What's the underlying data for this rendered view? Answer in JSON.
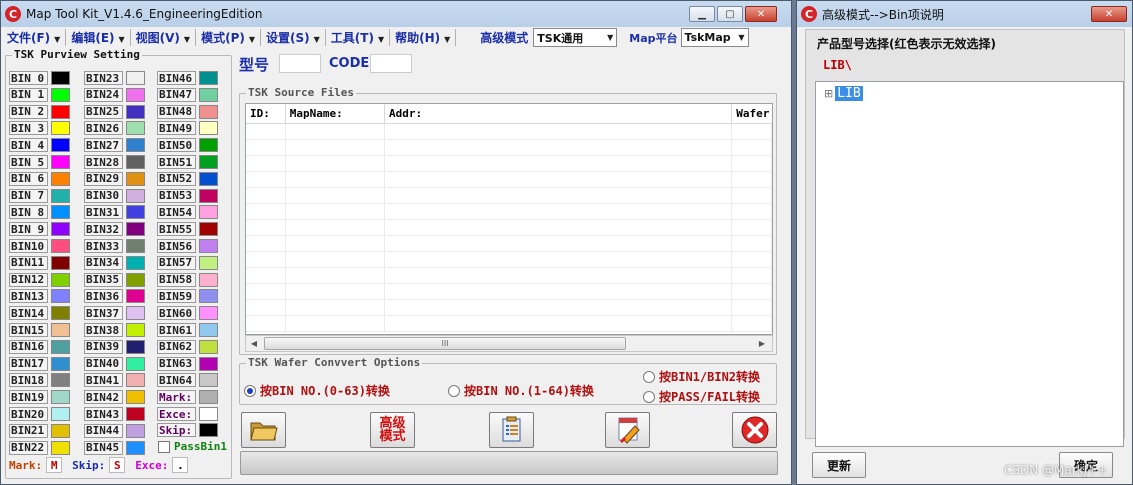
{
  "main": {
    "title": "Map Tool Kit_V1.4.6_EngineeringEdition",
    "menu": [
      {
        "label": "文件(F)"
      },
      {
        "label": "编辑(E)"
      },
      {
        "label": "视图(V)"
      },
      {
        "label": "模式(P)"
      },
      {
        "label": "设置(S)"
      },
      {
        "label": "工具(T)"
      },
      {
        "label": "帮助(H)"
      }
    ],
    "adv_mode_label": "高级模式",
    "adv_mode_value": "TSK通用",
    "platform_label": "Map平台",
    "platform_value": "TskMap",
    "tsk_purview_title": "TSK Purview Setting",
    "bins_col1": [
      {
        "label": "BIN 0",
        "color": "#000000"
      },
      {
        "label": "BIN 1",
        "color": "#00ff00"
      },
      {
        "label": "BIN 2",
        "color": "#ff0000"
      },
      {
        "label": "BIN 3",
        "color": "#ffff00"
      },
      {
        "label": "BIN 4",
        "color": "#0000ff"
      },
      {
        "label": "BIN 5",
        "color": "#ff00ff"
      },
      {
        "label": "BIN 6",
        "color": "#ff8000"
      },
      {
        "label": "BIN 7",
        "color": "#20b2aa"
      },
      {
        "label": "BIN 8",
        "color": "#0090ff"
      },
      {
        "label": "BIN 9",
        "color": "#9000ff"
      },
      {
        "label": "BIN10",
        "color": "#ff4f7f"
      },
      {
        "label": "BIN11",
        "color": "#800000"
      },
      {
        "label": "BIN12",
        "color": "#80d000"
      },
      {
        "label": "BIN13",
        "color": "#8080ff"
      },
      {
        "label": "BIN14",
        "color": "#808000"
      },
      {
        "label": "BIN15",
        "color": "#f0c090"
      },
      {
        "label": "BIN16",
        "color": "#4fa0a0"
      },
      {
        "label": "BIN17",
        "color": "#2f8fd0"
      },
      {
        "label": "BIN18",
        "color": "#808080"
      },
      {
        "label": "BIN19",
        "color": "#a0d8c8"
      },
      {
        "label": "BIN20",
        "color": "#b0f0f0"
      },
      {
        "label": "BIN21",
        "color": "#e0c000"
      },
      {
        "label": "BIN22",
        "color": "#f0e000"
      }
    ],
    "bins_col2": [
      {
        "label": "BIN23",
        "color": "#f0f0f0"
      },
      {
        "label": "BIN24",
        "color": "#f070f0"
      },
      {
        "label": "BIN25",
        "color": "#4030c0"
      },
      {
        "label": "BIN26",
        "color": "#a0e0b0"
      },
      {
        "label": "BIN27",
        "color": "#3080d0"
      },
      {
        "label": "BIN28",
        "color": "#606060"
      },
      {
        "label": "BIN29",
        "color": "#e09010"
      },
      {
        "label": "BIN30",
        "color": "#d0b0e0"
      },
      {
        "label": "BIN31",
        "color": "#4040e0"
      },
      {
        "label": "BIN32",
        "color": "#800080"
      },
      {
        "label": "BIN33",
        "color": "#708070"
      },
      {
        "label": "BIN34",
        "color": "#00b0b0"
      },
      {
        "label": "BIN35",
        "color": "#80a000"
      },
      {
        "label": "BIN36",
        "color": "#e00090"
      },
      {
        "label": "BIN37",
        "color": "#e0c0f0"
      },
      {
        "label": "BIN38",
        "color": "#c0f000"
      },
      {
        "label": "BIN39",
        "color": "#202070"
      },
      {
        "label": "BIN40",
        "color": "#30f0a0"
      },
      {
        "label": "BIN41",
        "color": "#f0b0b0"
      },
      {
        "label": "BIN42",
        "color": "#f0c000"
      },
      {
        "label": "BIN43",
        "color": "#c00020"
      },
      {
        "label": "BIN44",
        "color": "#c0a0e0"
      },
      {
        "label": "BIN45",
        "color": "#1e90ff"
      }
    ],
    "bins_col3": [
      {
        "label": "BIN46",
        "color": "#009090"
      },
      {
        "label": "BIN47",
        "color": "#70d0a0"
      },
      {
        "label": "BIN48",
        "color": "#f09090"
      },
      {
        "label": "BIN49",
        "color": "#ffffc0"
      },
      {
        "label": "BIN50",
        "color": "#00a000"
      },
      {
        "label": "BIN51",
        "color": "#00a020"
      },
      {
        "label": "BIN52",
        "color": "#0050d0"
      },
      {
        "label": "BIN53",
        "color": "#c00060"
      },
      {
        "label": "BIN54",
        "color": "#ffa0e0"
      },
      {
        "label": "BIN55",
        "color": "#a00000"
      },
      {
        "label": "BIN56",
        "color": "#c080f0"
      },
      {
        "label": "BIN57",
        "color": "#c0f080"
      },
      {
        "label": "BIN58",
        "color": "#ffb0d0"
      },
      {
        "label": "BIN59",
        "color": "#9090f0"
      },
      {
        "label": "BIN60",
        "color": "#ff90ff"
      },
      {
        "label": "BIN61",
        "color": "#90c8f0"
      },
      {
        "label": "BIN62",
        "color": "#c0e040"
      },
      {
        "label": "BIN63",
        "color": "#b000b0"
      },
      {
        "label": "BIN64",
        "color": "#c8c8c8"
      }
    ],
    "mark_label": "Mark:",
    "mark_color": "#b0b0b0",
    "exce_label": "Exce:",
    "exce_color": "#ffffff",
    "skip_label": "Skip:",
    "skip_color": "#000000",
    "passbin_label": "PassBin1",
    "bottom_mark_label": "Mark:",
    "bottom_mark_value": "M",
    "bottom_skip_label": "Skip:",
    "bottom_skip_value": "S",
    "bottom_exce_label": "Exce:",
    "bottom_exce_value": ".",
    "model_label": "型号",
    "code_label": "CODE",
    "source_title": "TSK Source Files",
    "columns": [
      "ID:",
      "MapName:",
      "Addr:",
      "Wafer"
    ],
    "convert_title": "TSK Wafer Convvert Options",
    "opt1": "按BIN NO.(0-63)转换",
    "opt2": "按BIN NO.(1-64)转换",
    "opt3": "按BIN1/BIN2转换",
    "opt4": "按PASS/FAIL转换",
    "adv_btn_text": "高级\n模式"
  },
  "side": {
    "title": "高级模式-->Bin项说明",
    "heading": "产品型号选择(红色表示无效选择)",
    "path": "LIB\\",
    "tree_root": "LIB",
    "tree_expander": "⊞",
    "refresh_btn": "更新",
    "ok_btn": "确定"
  },
  "watermark": "CSDN @MarkJ++"
}
